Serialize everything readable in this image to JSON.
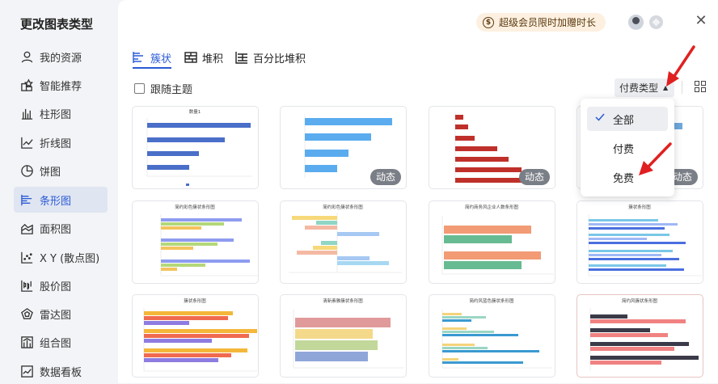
{
  "sidebar": {
    "title": "更改图表类型",
    "items": [
      {
        "label": "我的资源",
        "icon": "user-icon"
      },
      {
        "label": "智能推荐",
        "icon": "smart-icon"
      },
      {
        "label": "柱形图",
        "icon": "column-chart-icon"
      },
      {
        "label": "折线图",
        "icon": "line-chart-icon"
      },
      {
        "label": "饼图",
        "icon": "pie-chart-icon"
      },
      {
        "label": "条形图",
        "icon": "bar-chart-icon",
        "active": true
      },
      {
        "label": "面积图",
        "icon": "area-chart-icon"
      },
      {
        "label": "X Y (散点图)",
        "icon": "scatter-chart-icon"
      },
      {
        "label": "股价图",
        "icon": "stock-chart-icon"
      },
      {
        "label": "雷达图",
        "icon": "radar-chart-icon"
      },
      {
        "label": "组合图",
        "icon": "combo-chart-icon"
      },
      {
        "label": "数据看板",
        "icon": "dashboard-icon"
      }
    ]
  },
  "header": {
    "promo": "超级会员限时加赠时长",
    "promo_coin": "$",
    "close": "✕"
  },
  "tabs": [
    {
      "label": "簇状",
      "active": true
    },
    {
      "label": "堆积"
    },
    {
      "label": "百分比堆积"
    }
  ],
  "toolbar": {
    "follow_theme": "跟随主题",
    "follow_checked": false,
    "pay_type": "付费类型"
  },
  "dropdown": {
    "options": [
      {
        "label": "全部",
        "selected": true
      },
      {
        "label": "付费"
      },
      {
        "label": "免费"
      }
    ]
  },
  "cards": [
    {
      "title": "数量1",
      "badge": ""
    },
    {
      "title": "",
      "badge": "动态"
    },
    {
      "title": "",
      "badge": "动态"
    },
    {
      "title": "",
      "badge": "动态"
    },
    {
      "title": "简约彩色簇状条形图",
      "badge": ""
    },
    {
      "title": "简约彩色簇状条形图",
      "badge": ""
    },
    {
      "title": "简约商务风企业人数条形图",
      "badge": ""
    },
    {
      "title": "簇状条形图",
      "badge": ""
    },
    {
      "title": "簇状条形图",
      "badge": ""
    },
    {
      "title": "清新素雅簇状条形图",
      "badge": ""
    },
    {
      "title": "简约风蓝色簇状条形图",
      "badge": ""
    },
    {
      "title": "简约风簇状条形图",
      "badge": ""
    }
  ],
  "colors": {
    "accent": "#2a5ad6",
    "arrow": "#e02020"
  }
}
